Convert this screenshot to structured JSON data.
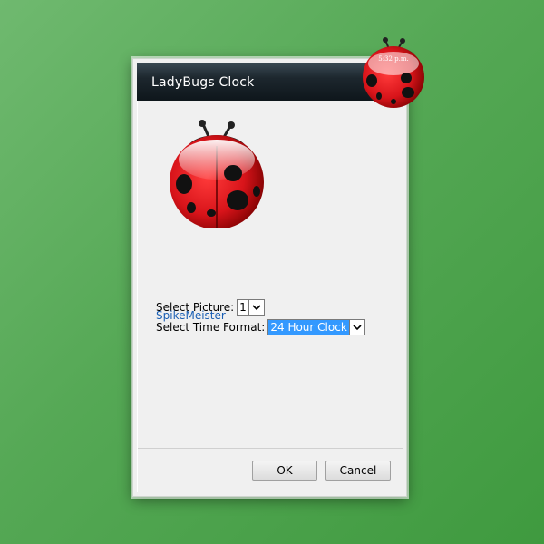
{
  "dialog": {
    "title": "LadyBugs Clock",
    "select_picture": {
      "label": "Select Picture:",
      "value": "1"
    },
    "select_time_format": {
      "label": "Select Time Format:",
      "value": "24 Hour Clock"
    },
    "author_link": "SpikeMeister",
    "ok_label": "OK",
    "cancel_label": "Cancel"
  },
  "gadget": {
    "time": "5:32 p.m."
  },
  "colors": {
    "accent": "#3399ff",
    "ladybug_red": "#d8141a",
    "link": "#1a5fb4"
  }
}
